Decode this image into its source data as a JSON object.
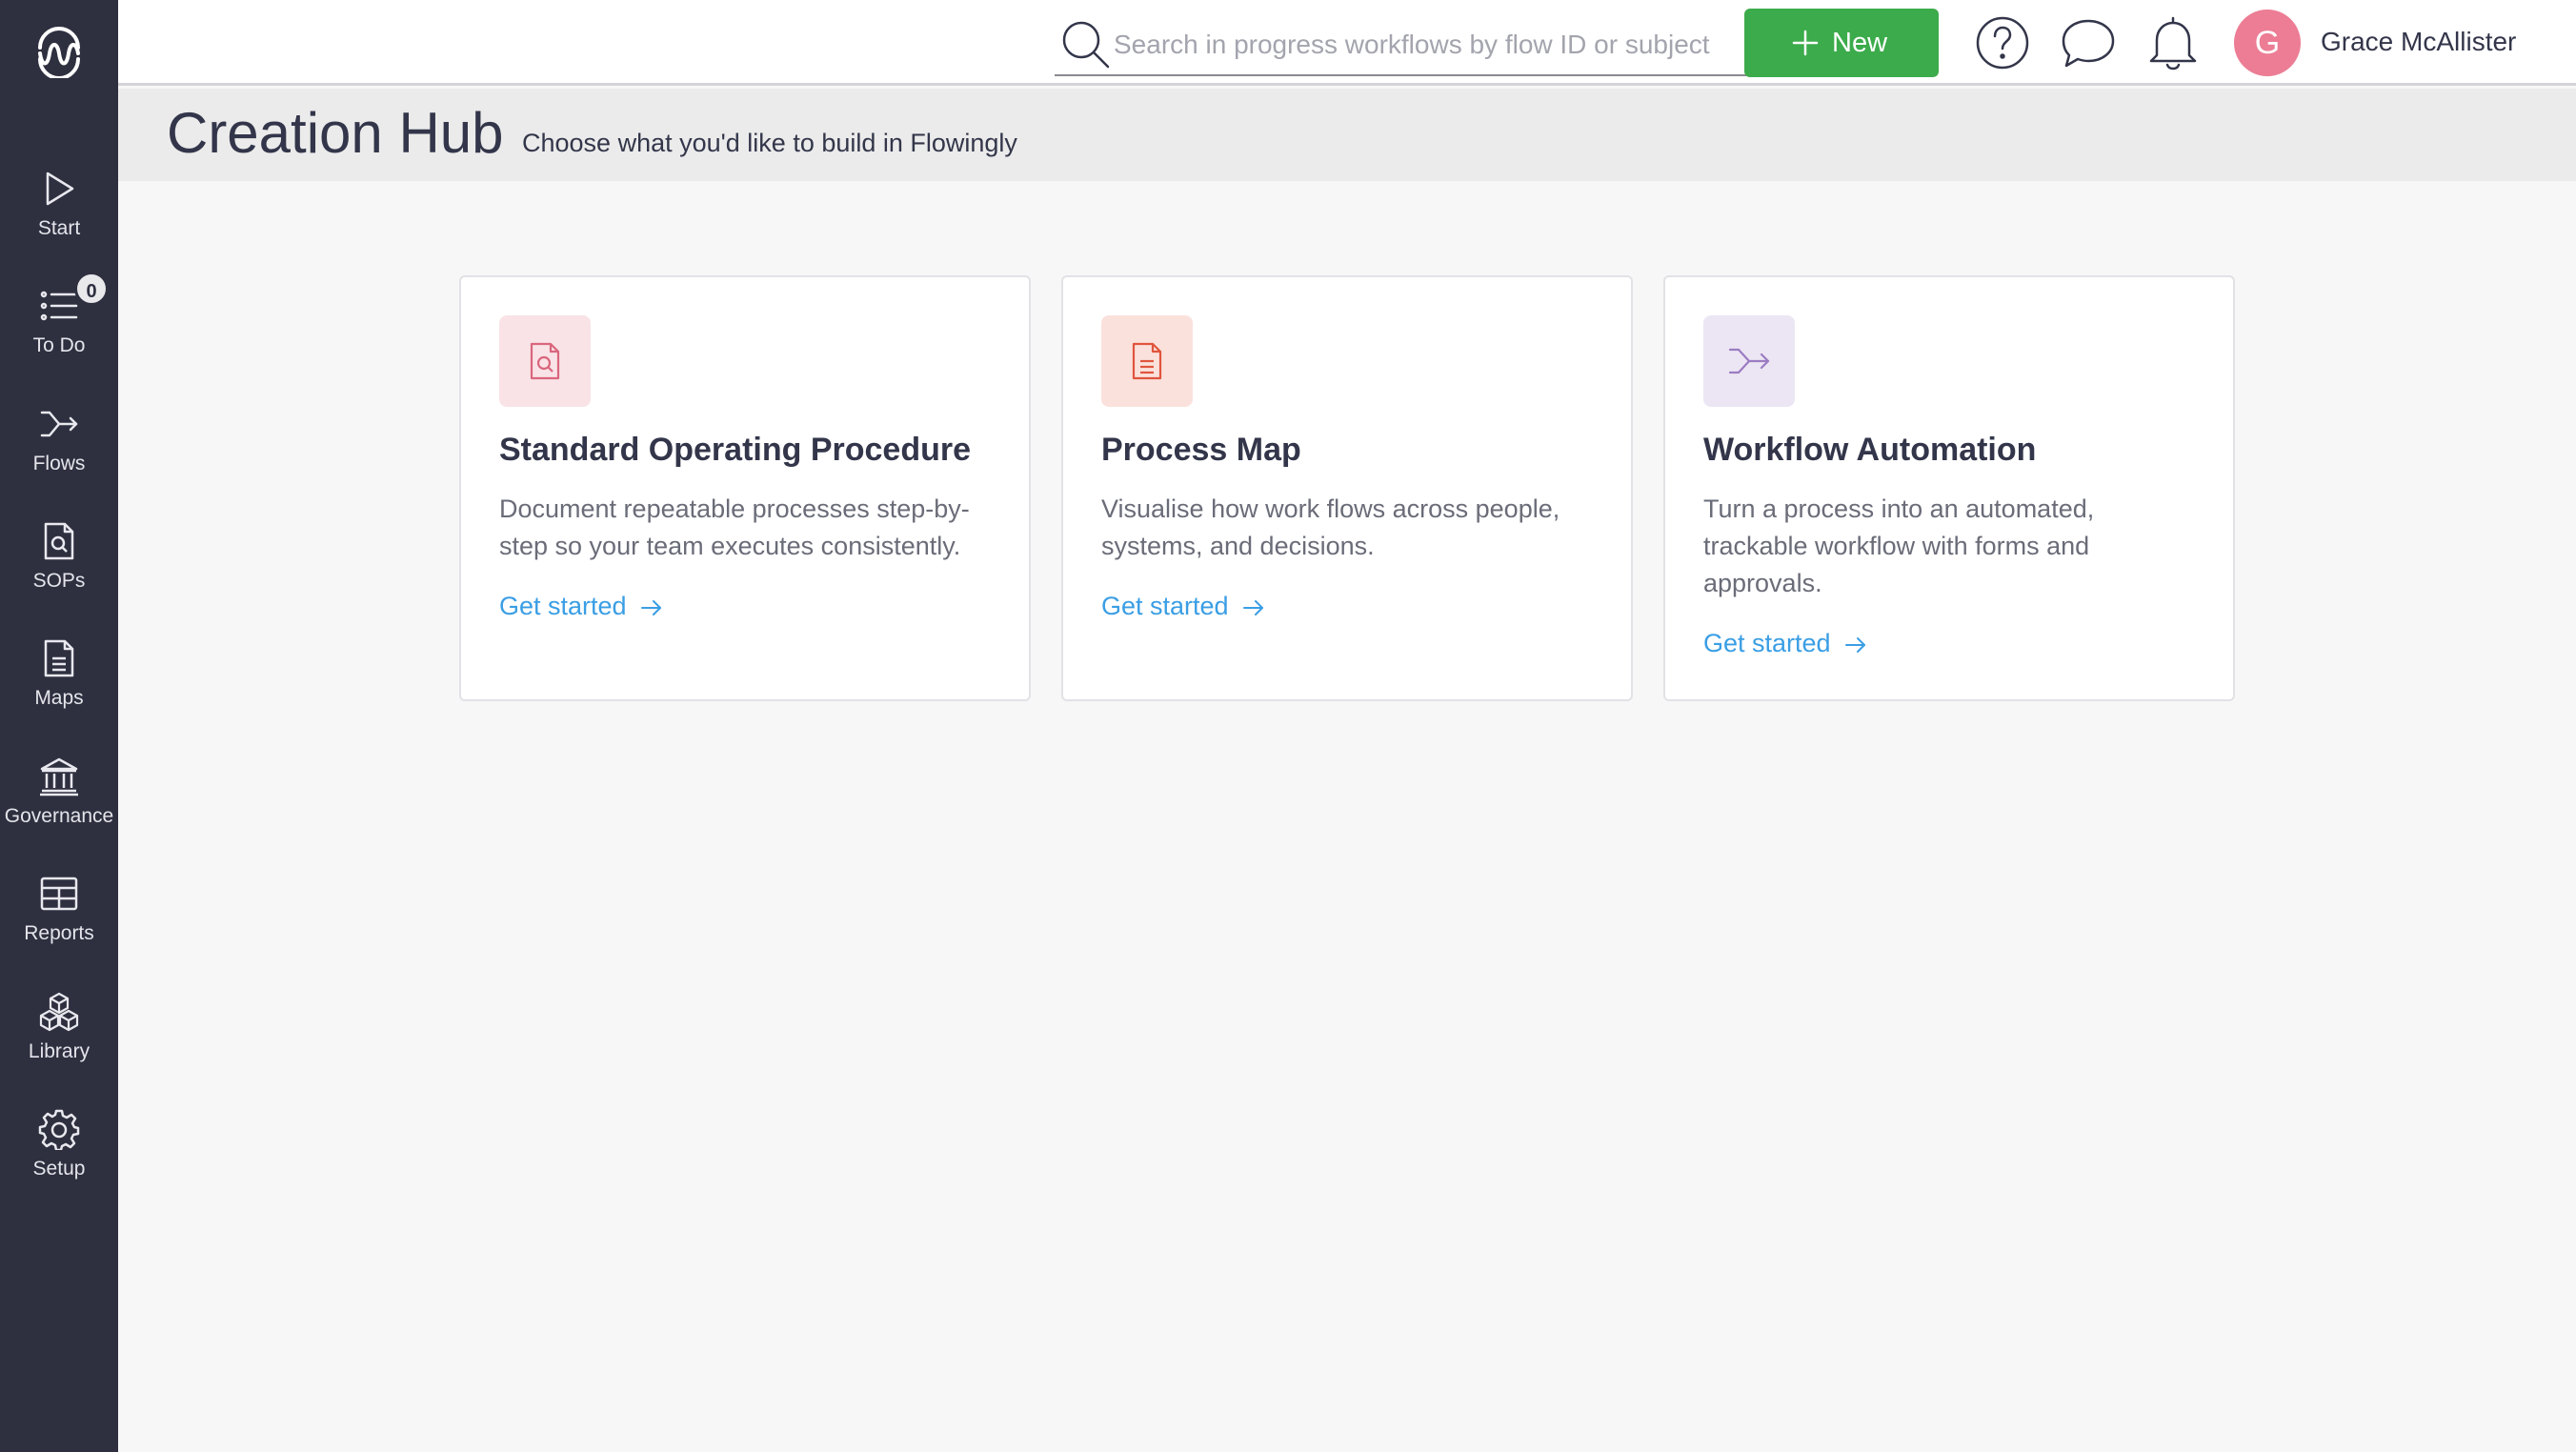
{
  "app": {
    "logo_icon": "flowingly-logo-icon"
  },
  "sidebar": {
    "items": [
      {
        "label": "Start",
        "icon": "play-icon"
      },
      {
        "label": "To Do",
        "icon": "list-icon",
        "badge": "0"
      },
      {
        "label": "Flows",
        "icon": "flows-icon"
      },
      {
        "label": "SOPs",
        "icon": "document-search-icon"
      },
      {
        "label": "Maps",
        "icon": "document-icon"
      },
      {
        "label": "Governance",
        "icon": "bank-icon"
      },
      {
        "label": "Reports",
        "icon": "table-icon"
      },
      {
        "label": "Library",
        "icon": "cubes-icon"
      },
      {
        "label": "Setup",
        "icon": "gear-icon"
      }
    ]
  },
  "topbar": {
    "search_placeholder": "Search in progress workflows by flow ID or subject",
    "new_label": "New",
    "icons": [
      "help-icon",
      "chat-icon",
      "bell-icon"
    ],
    "user": {
      "initial": "G",
      "name": "Grace McAllister",
      "avatar_color": "#ec7d95"
    }
  },
  "header": {
    "title": "Creation Hub",
    "subtitle": "Choose what you'd like to build in Flowingly"
  },
  "cards": [
    {
      "title": "Standard Operating Procedure",
      "description": "Document repeatable processes step-by-step so your team executes consistently.",
      "link": "Get started",
      "icon": "document-search-icon",
      "icon_bg": "#f9e3e7",
      "icon_color": "#d9667c"
    },
    {
      "title": "Process Map",
      "description": "Visualise how work flows across people, systems, and decisions.",
      "link": "Get started",
      "icon": "document-icon",
      "icon_bg": "#fbe1dc",
      "icon_color": "#e0553d"
    },
    {
      "title": "Workflow Automation",
      "description": "Turn a process into an automated, trackable workflow with forms and approvals.",
      "link": "Get started",
      "icon": "flows-icon",
      "icon_bg": "#ece6f4",
      "icon_color": "#9b7cc2"
    }
  ],
  "colors": {
    "sidebar_bg": "#2e3040",
    "accent_green": "#3cab4b",
    "link_blue": "#3a9ee4"
  }
}
